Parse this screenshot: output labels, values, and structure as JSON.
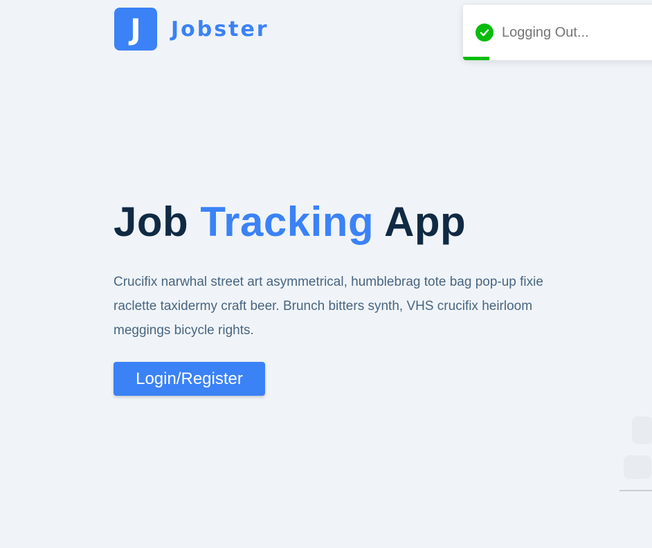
{
  "brand": {
    "logo_letter": "J",
    "name": "Jobster",
    "color": "#3b82f6"
  },
  "toast": {
    "message": "Logging Out...",
    "icon": "check-circle-icon",
    "color": "#07bc0c",
    "progress": 0.13
  },
  "hero": {
    "title_part1": "Job",
    "title_accent": "Tracking",
    "title_part2": "App",
    "description": "Crucifix narwhal street art asymmetrical, humblebrag tote bag pop-up fixie raclette taxidermy craft beer. Brunch bitters synth, VHS crucifix heirloom meggings bicycle rights.",
    "button_label": "Login/Register"
  },
  "colors": {
    "background": "#f0f4f8",
    "heading": "#102a43",
    "body_text": "#486581"
  }
}
